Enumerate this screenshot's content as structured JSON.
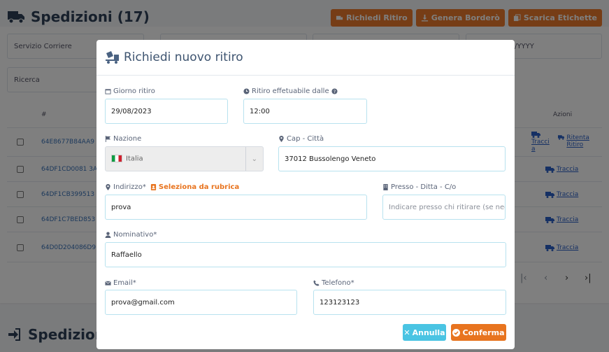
{
  "page": {
    "title": "Spedizioni (17)",
    "section2_title": "Spedizioni",
    "actions": {
      "ritiro": "Richiedi Ritiro",
      "bordero": "Genera Borderò",
      "etichette": "Scarica Etichette"
    },
    "filters": {
      "servizio_corriere": "Servizio Corriere",
      "date_placeholder": "/YYYY",
      "ricerca": "Ricerca"
    },
    "table": {
      "col_hash": "#",
      "col_azioni": "Azioni",
      "rows": [
        {
          "id": "64E8677B84AA9",
          "action": "Tracci a",
          "action2": "Ritenta Ritiro"
        },
        {
          "id": "64DF1CD0081 3A",
          "action": "Traccia"
        },
        {
          "id": "64DF1CB399513",
          "action": "Traccia"
        },
        {
          "id": "64DF1C7BED853",
          "action": "Traccia"
        },
        {
          "id": "64D0D204086D9",
          "action": "Traccia"
        }
      ]
    },
    "pager": {
      "first": "|‹",
      "prev": "‹",
      "next": "›",
      "last": "›|"
    }
  },
  "modal": {
    "title": "Richiedi nuovo ritiro",
    "fields": {
      "giorno_label": "Giorno ritiro",
      "giorno_value": "29/08/2023",
      "dalle_label": "Ritiro effetuabile dalle",
      "dalle_value": "12:00",
      "nazione_label": "Nazione",
      "nazione_value": "Italia",
      "cap_label": "Cap - Città",
      "cap_value": "37012 Bussolengo Veneto",
      "indirizzo_label": "Indirizzo*",
      "rubrica_link": "Seleziona da rubrica",
      "indirizzo_value": "prova",
      "presso_label": "Presso - Ditta - C/o",
      "presso_placeholder": "Indicare presso chi ritirare (se nec",
      "nominativo_label": "Nominativo*",
      "nominativo_value": "Raffaello",
      "email_label": "Email*",
      "email_value": "prova@gmail.com",
      "telefono_label": "Telefono*",
      "telefono_value": "123123123"
    },
    "buttons": {
      "annulla": "Annulla",
      "conferma": "Conferma"
    }
  },
  "colors": {
    "accent_orange": "#e8741f",
    "accent_cyan": "#4ac4e3",
    "link_blue": "#2a60c8"
  }
}
